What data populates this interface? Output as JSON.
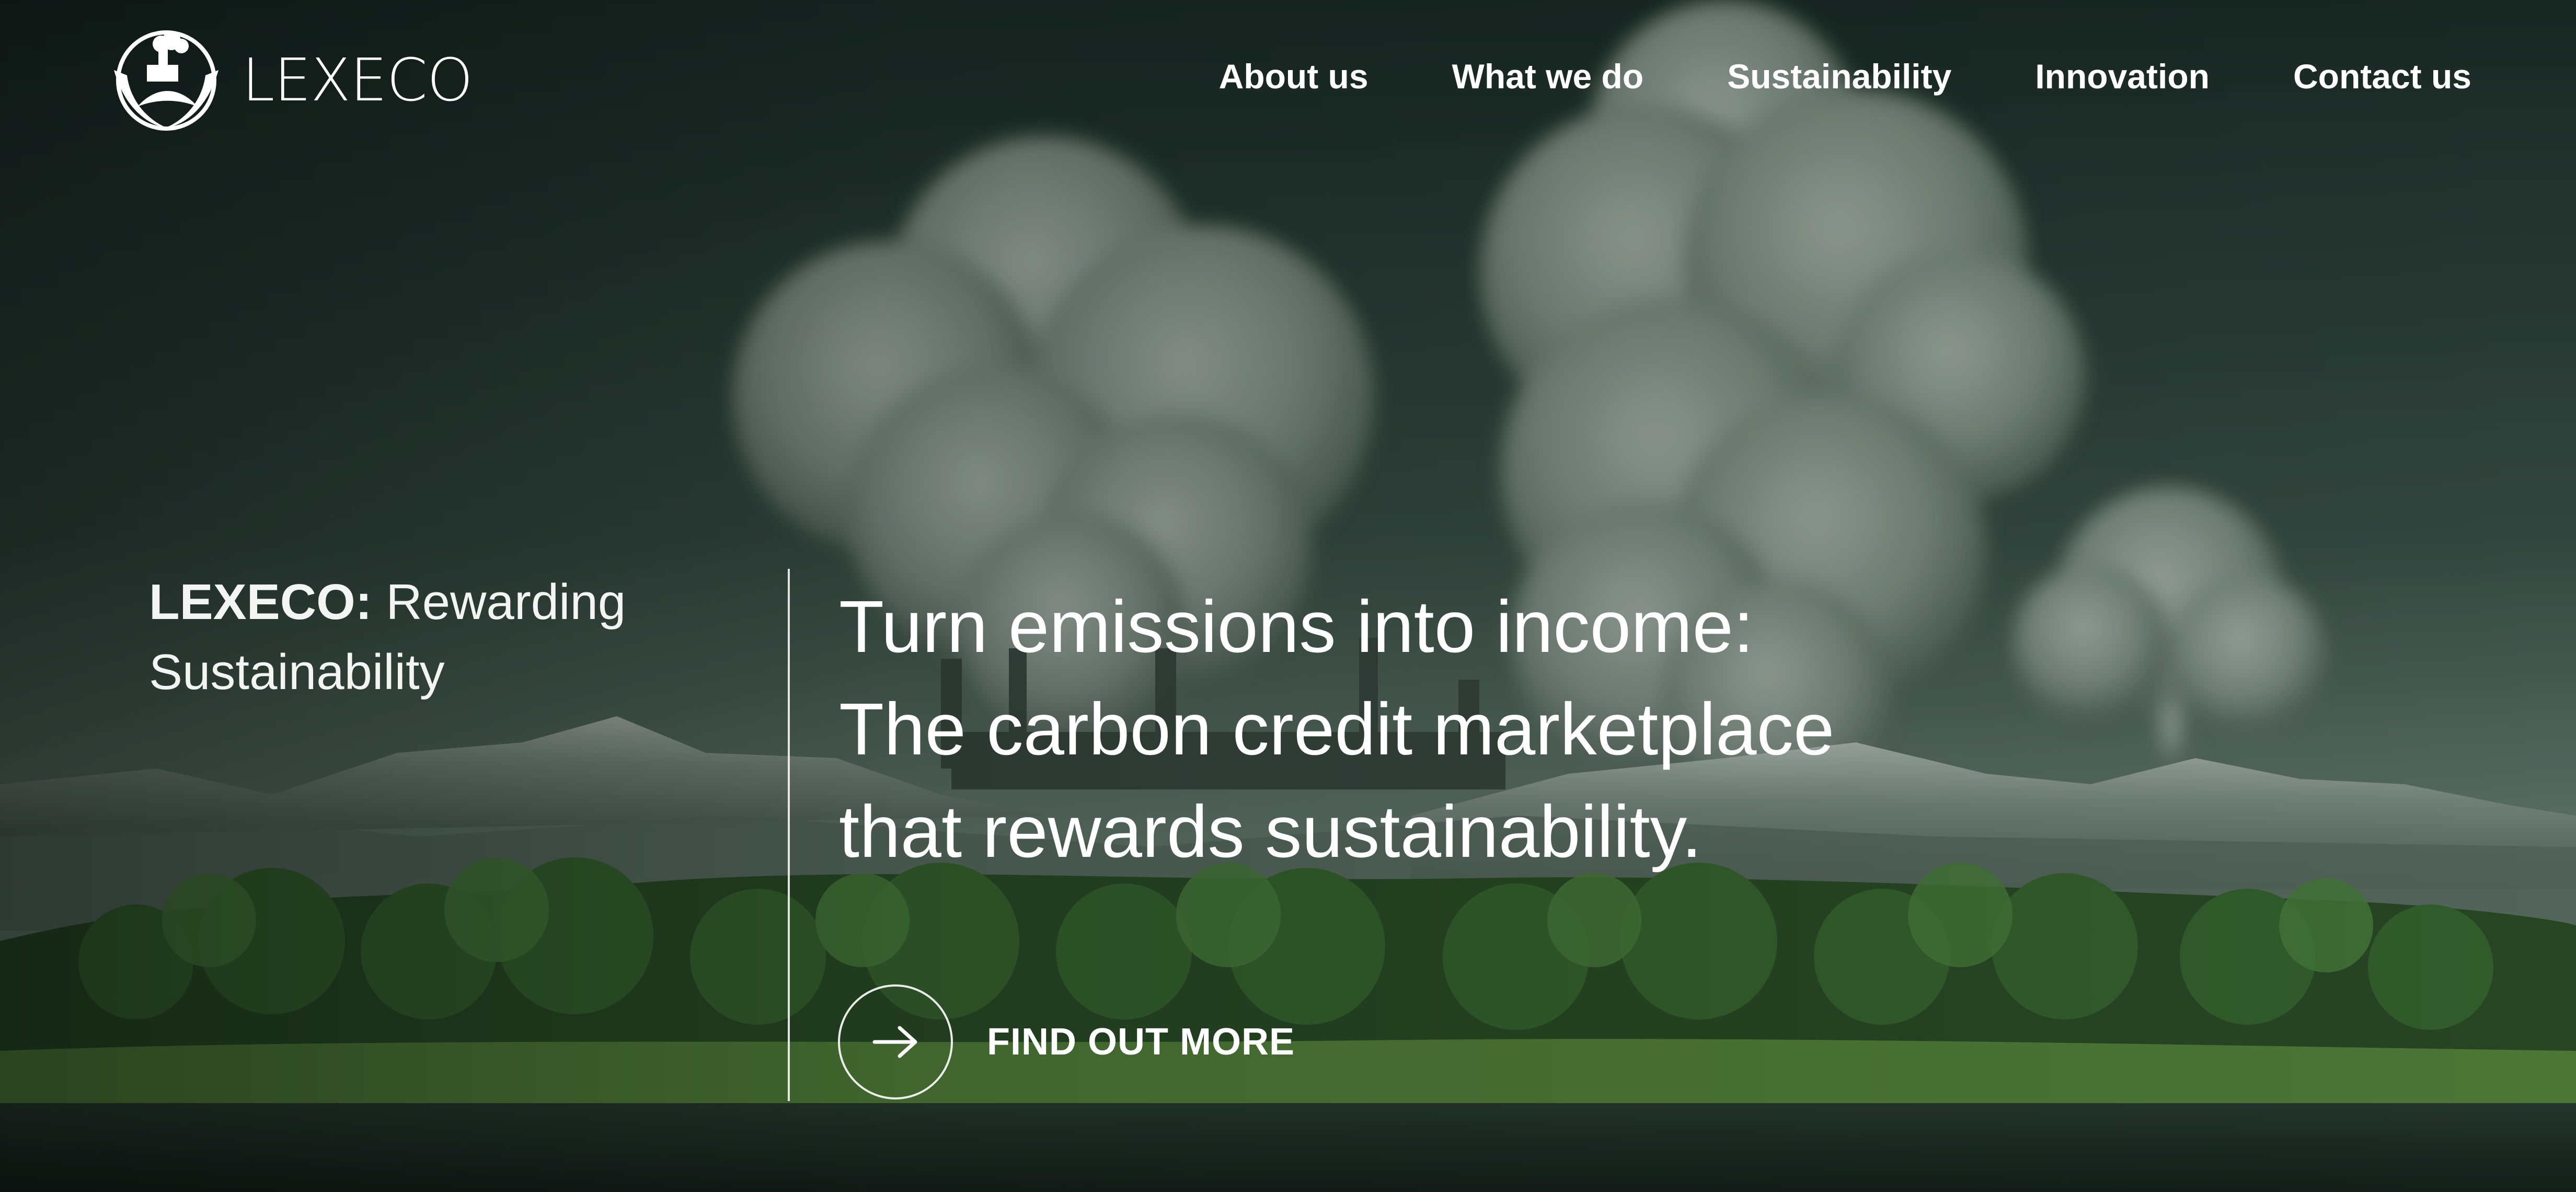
{
  "brand": {
    "name": "LEXECO"
  },
  "nav": {
    "items": [
      {
        "label": "About us"
      },
      {
        "label": "What we do"
      },
      {
        "label": "Sustainability"
      },
      {
        "label": "Innovation"
      },
      {
        "label": "Contact us"
      }
    ]
  },
  "hero": {
    "tagline_brand": "LEXECO:",
    "tagline_rest": " Rewarding Sustainability",
    "headline_lines": [
      "Turn emissions into income:",
      "The carbon credit marketplace",
      "that rewards sustainability."
    ],
    "cta_label": "FIND OUT MORE",
    "cta_icon": "arrow-right-icon"
  },
  "colors": {
    "sky_top": "#1b2a26",
    "sky_bottom": "#5f786c",
    "forest": "#2f5a2a",
    "grass": "#4f7d3a",
    "water": "#1f2d27",
    "text": "#ffffff"
  }
}
